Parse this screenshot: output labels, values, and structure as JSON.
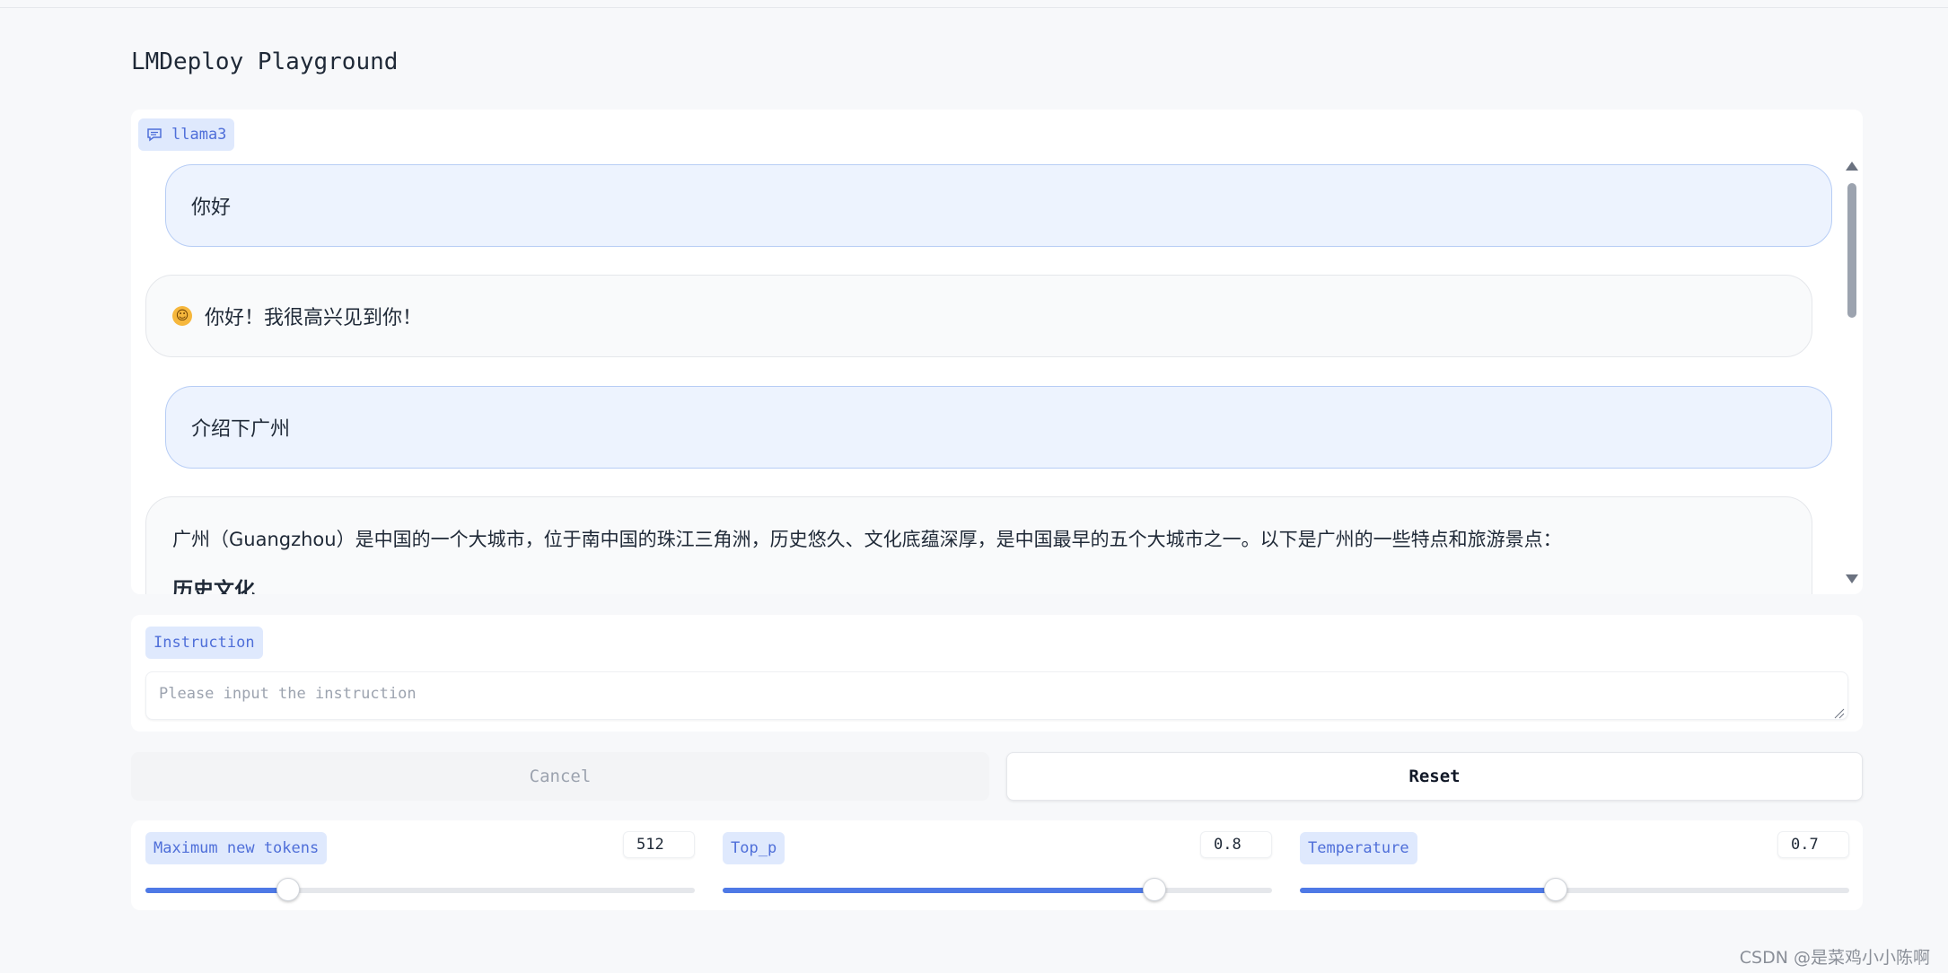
{
  "app": {
    "title": "LMDeploy Playground"
  },
  "chat": {
    "label": "llama3",
    "messages": [
      {
        "role": "user",
        "text": "你好"
      },
      {
        "role": "assistant",
        "emoji": "😊",
        "text": "你好！我很高兴见到你！"
      },
      {
        "role": "user",
        "text": "介绍下广州"
      },
      {
        "role": "assistant",
        "text": "广州（Guangzhou）是中国的一个大城市，位于南中国的珠江三角洲，历史悠久、文化底蕴深厚，是中国最早的五个大城市之一。以下是广州的一些特点和旅游景点：",
        "heading": "历史文化"
      }
    ]
  },
  "instruction": {
    "label": "Instruction",
    "placeholder": "Please input the instruction",
    "value": ""
  },
  "buttons": {
    "cancel": "Cancel",
    "reset": "Reset"
  },
  "sliders": [
    {
      "label": "Maximum new tokens",
      "value": "512",
      "fraction": 0.26
    },
    {
      "label": "Top_p",
      "value": "0.8",
      "fraction": 0.786
    },
    {
      "label": "Temperature",
      "value": "0.7",
      "fraction": 0.465
    }
  ],
  "icons": {
    "chat_label_icon": "chat-bubble-icon",
    "scroll_up": "triangle-up-icon",
    "scroll_down": "triangle-down-icon",
    "resize": "resize-grip-icon"
  },
  "colors": {
    "accent": "#4e79e6",
    "tag_bg": "#dfe9fd",
    "tag_text": "#4f6fd9",
    "user_bubble": "#edf3fe"
  },
  "watermark": "CSDN @是菜鸡小小陈啊"
}
